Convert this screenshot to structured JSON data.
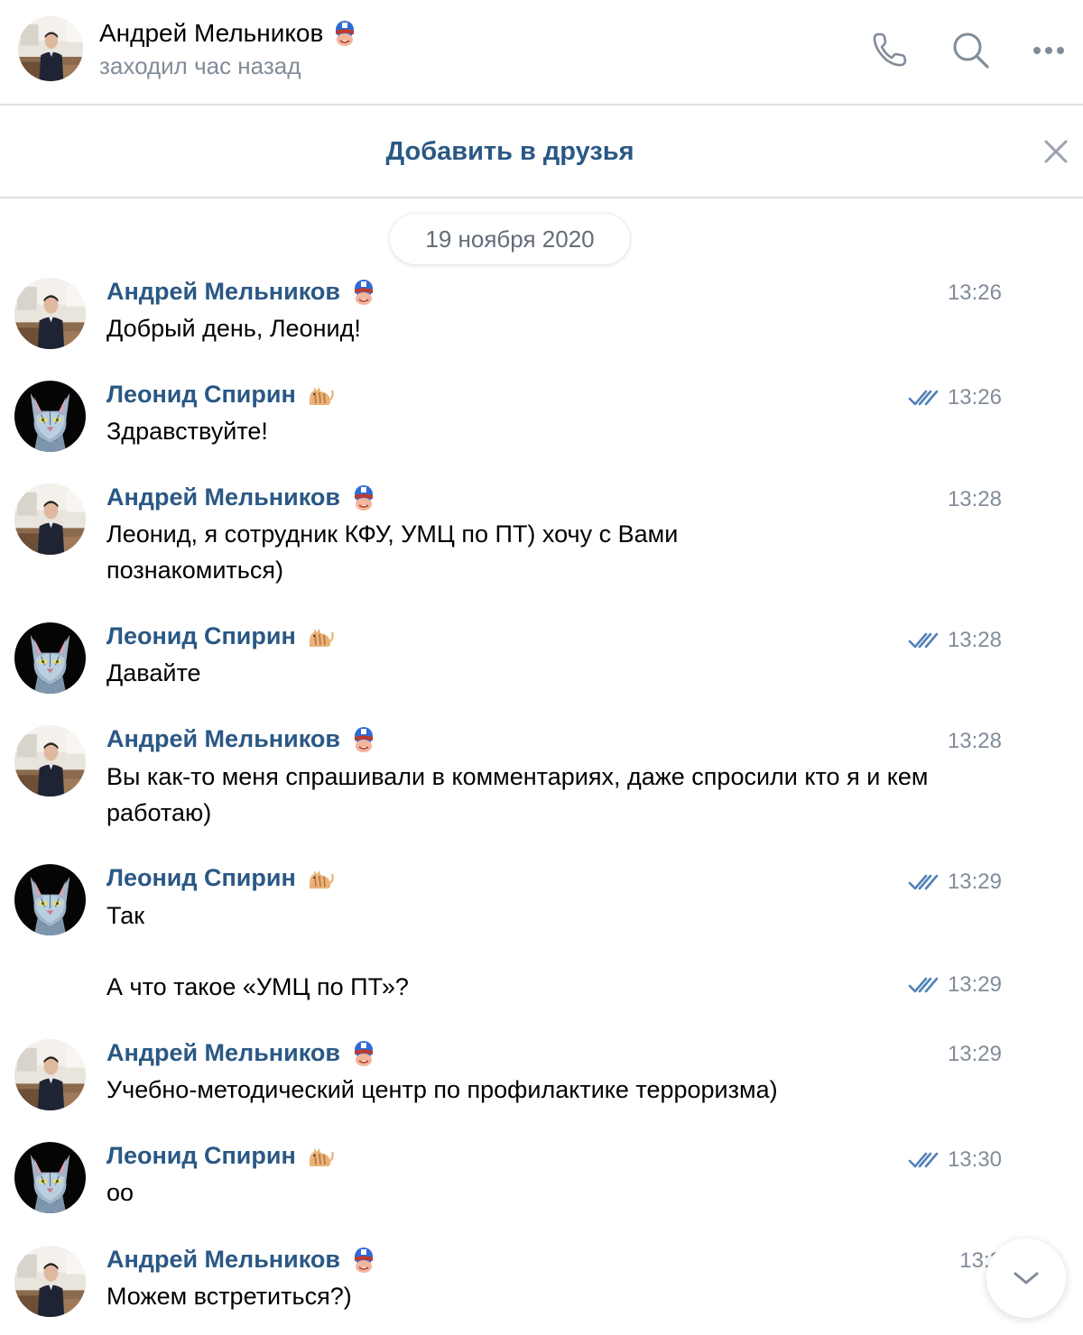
{
  "header": {
    "name": "Андрей Мельников",
    "status": "заходил час назад",
    "call_icon": "phone-icon",
    "search_icon": "search-icon",
    "more_icon": "more-icon"
  },
  "friend_bar": {
    "add_label": "Добавить в друзья",
    "close_icon": "close-icon"
  },
  "date_separator": "19 ноября 2020",
  "messages": [
    {
      "author": "Андрей Мельников",
      "text": "Добрый день, Леонид!",
      "time": "13:26",
      "read": false
    },
    {
      "author": "Леонид Спирин",
      "text": "Здравствуйте!",
      "time": "13:26",
      "read": true
    },
    {
      "author": "Андрей Мельников",
      "text": "Леонид, я сотрудник КФУ, УМЦ по ПТ) хочу с Вами познакомиться)",
      "time": "13:28",
      "read": false
    },
    {
      "author": "Леонид Спирин",
      "text": "Давайте",
      "time": "13:28",
      "read": true
    },
    {
      "author": "Андрей Мельников",
      "text": "Вы как-то меня спрашивали в комментариях, даже спросили кто я и кем работаю)",
      "time": "13:28",
      "read": false
    },
    {
      "author": "Леонид Спирин",
      "text": "Так",
      "time": "13:29",
      "read": true
    },
    {
      "author": "",
      "text": "А что такое «УМЦ по ПТ»?",
      "time": "13:29",
      "read": true
    },
    {
      "author": "Андрей Мельников",
      "text": "Учебно-методический центр по профилактике терроризма)",
      "time": "13:29",
      "read": false
    },
    {
      "author": "Леонид Спирин",
      "text": "оо",
      "time": "13:30",
      "read": true
    },
    {
      "author": "Андрей Мельников",
      "text": "Можем встретиться?)",
      "time": "13:3",
      "read": false
    }
  ],
  "scroll_down_icon": "chevron-down-icon",
  "colors": {
    "link": "#2a5885",
    "secondary": "#818c99",
    "check": "#5181b8",
    "divider": "#dce1e6"
  }
}
